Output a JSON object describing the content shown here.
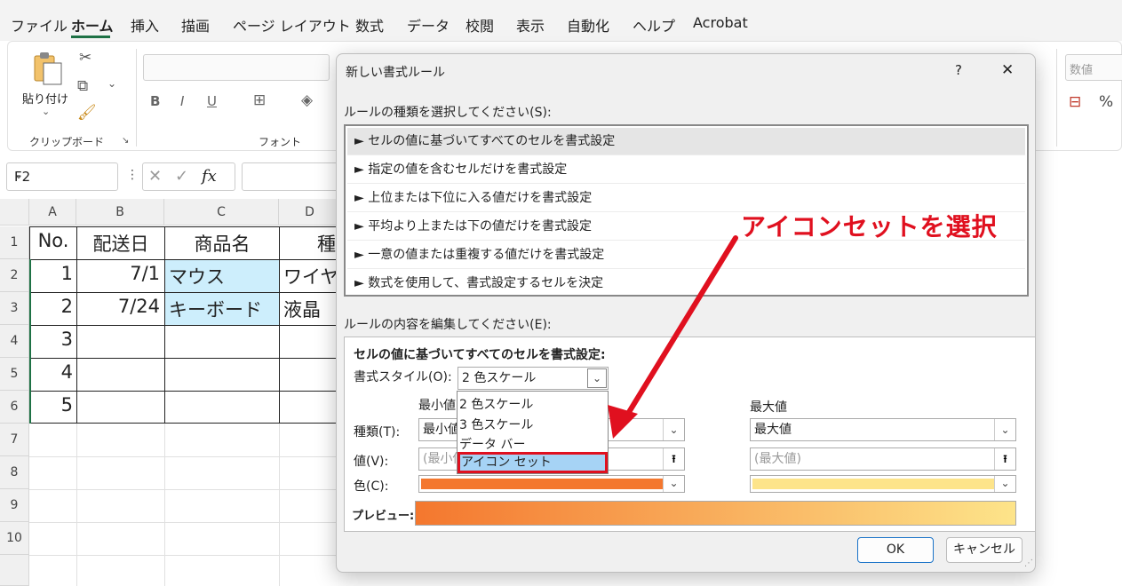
{
  "ribbon": {
    "tabs": [
      "ファイル",
      "ホーム",
      "挿入",
      "描画",
      "ページ レイアウト",
      "数式",
      "データ",
      "校閲",
      "表示",
      "自動化",
      "ヘルプ",
      "Acrobat"
    ],
    "paste_label": "貼り付け",
    "clipboard_group": "クリップボード",
    "font_group": "フォント",
    "number_format": "数値"
  },
  "formula_bar": {
    "name_box": "F2",
    "fx": "fx"
  },
  "sheet": {
    "columns": [
      "A",
      "B",
      "C",
      "D"
    ],
    "rows": [
      "1",
      "2",
      "3",
      "4",
      "5",
      "6",
      "7",
      "8",
      "9",
      "10"
    ],
    "header": {
      "no": "No.",
      "date": "配送日",
      "product": "商品名",
      "type": "種"
    },
    "r2": {
      "no": "1",
      "date": "7/1",
      "product": "マウス",
      "type": "ワイヤ"
    },
    "r3": {
      "no": "2",
      "date": "7/24",
      "product": "キーボード",
      "type": "液晶"
    },
    "r4": {
      "no": "3"
    },
    "r5": {
      "no": "4"
    },
    "r6": {
      "no": "5"
    }
  },
  "dialog": {
    "title": "新しい書式ルール",
    "help": "?",
    "close": "✕",
    "select_type_label": "ルールの種類を選択してください(S):",
    "rule_types": [
      "セルの値に基づいてすべてのセルを書式設定",
      "指定の値を含むセルだけを書式設定",
      "上位または下位に入る値だけを書式設定",
      "平均より上または下の値だけを書式設定",
      "一意の値または重複する値だけを書式設定",
      "数式を使用して、書式設定するセルを決定"
    ],
    "rule_bullet": "►",
    "edit_label": "ルールの内容を編集してください(E):",
    "edit_heading": "セルの値に基づいてすべてのセルを書式設定:",
    "format_style_label": "書式スタイル(O):",
    "format_style_value": "2 色スケール",
    "style_options": [
      "2 色スケール",
      "3 色スケール",
      "データ バー",
      "アイコン セット"
    ],
    "min_header": "最小値",
    "max_header": "最大値",
    "type_label": "種類(T):",
    "value_label": "値(V):",
    "color_label": "色(C):",
    "min_type": "最小値",
    "max_type": "最大値",
    "min_value_placeholder": "(最小値)",
    "max_value_placeholder": "(最大値)",
    "preview_label": "プレビュー:",
    "ok": "OK",
    "cancel": "キャンセル",
    "min_color": "#f4772e",
    "max_color": "#fde48a"
  },
  "annotation": {
    "text": "アイコンセットを選択",
    "color": "#e0101f"
  }
}
